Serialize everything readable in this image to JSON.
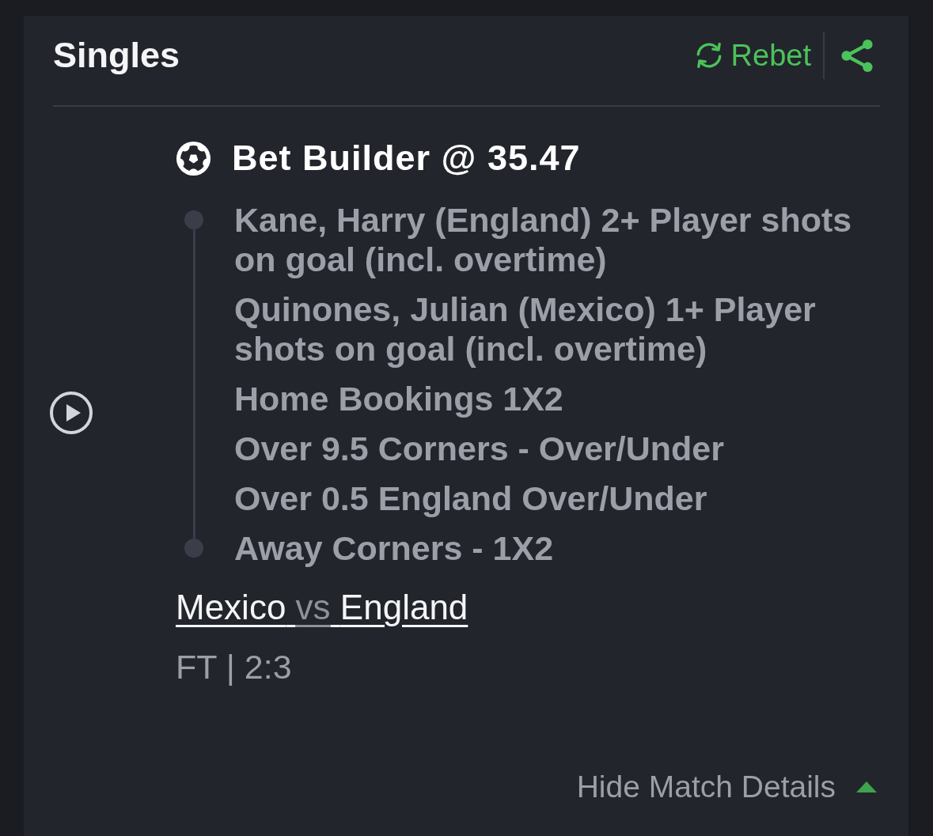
{
  "card": {
    "title": "Singles",
    "rebet_label": "Rebet"
  },
  "bet": {
    "title": "Bet Builder @ 35.47",
    "legs": [
      "Kane, Harry (England) 2+ Player shots on goal (incl. overtime)",
      "Quinones, Julian (Mexico) 1+ Player shots on goal (incl. overtime)",
      "Home Bookings 1X2",
      "Over 9.5 Corners - Over/Under",
      "Over 0.5 England Over/Under",
      "Away Corners - 1X2"
    ],
    "match": {
      "home_team": "Mexico",
      "separator": "vs",
      "away_team": "England"
    },
    "status": "FT | 2:3"
  },
  "details_toggle": {
    "label": "Hide Match Details",
    "expanded": true
  }
}
